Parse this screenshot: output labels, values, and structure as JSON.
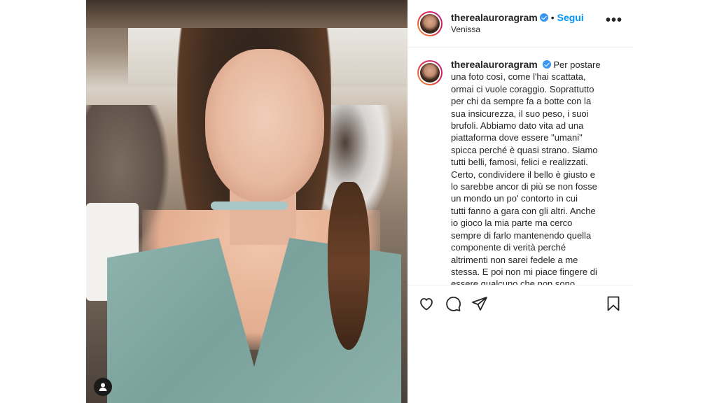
{
  "post": {
    "username": "therealauroragram",
    "verified": true,
    "separator": "•",
    "follow_label": "Segui",
    "location": "Venissa",
    "more_label": "•••",
    "caption": "Per postare\nuna foto così, come l'hai scattata,\normai ci vuole coraggio. Soprattutto\nper chi da sempre fa a botte con la\nsua insicurezza, il suo peso, i suoi\nbrufoli. Abbiamo dato vita ad una\npiattaforma dove essere \"umani\"\nspicca perché è quasi strano. Siamo\ntutti belli, famosi, felici e realizzati.\nCerto, condividere il bello è giusto e\nlo sarebbe ancor di più se non fosse\nun mondo un po' contorto in cui\ntutti fanno a gara con gli altri. Anche\nio gioco la mia parte ma cerco\nsempre di farlo mantenendo quella\ncomponente di verità perché\naltrimenti non sarei fedele a me\nstessa. E poi non mi piace fingere di\nessere qualcuno che non sono.\nTroverò sempre assurdo che"
  },
  "icons": {
    "like": "heart-icon",
    "comment": "comment-icon",
    "share": "share-icon",
    "save": "bookmark-icon",
    "tag": "user-tag-icon",
    "verified": "verified-badge-icon"
  },
  "colors": {
    "accent": "#0095f6",
    "verified": "#3897f0",
    "text": "#262626",
    "divider": "#efefef"
  }
}
